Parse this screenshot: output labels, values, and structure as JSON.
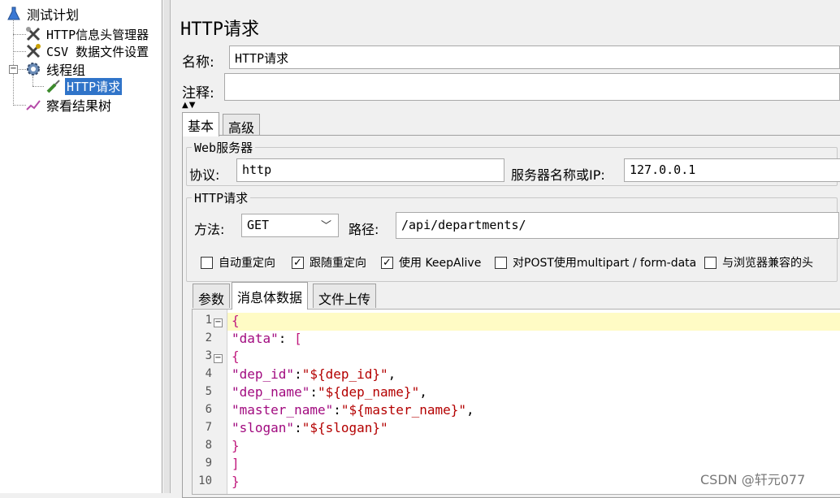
{
  "tree": {
    "root": "测试计划",
    "header_manager": "HTTP信息头管理器",
    "csv_config": "CSV 数据文件设置",
    "thread_group": "线程组",
    "http_request": "HTTP请求",
    "result_tree": "察看结果树"
  },
  "panel": {
    "title": "HTTP请求",
    "name_label": "名称:",
    "name_value": "HTTP请求",
    "comment_label": "注释:",
    "comment_value": ""
  },
  "tabs": {
    "basic": "基本",
    "advanced": "高级"
  },
  "web_server": {
    "legend": "Web服务器",
    "protocol_label": "协议:",
    "protocol_value": "http",
    "server_label": "服务器名称或IP:",
    "server_value": "127.0.0.1"
  },
  "http_section": {
    "legend": "HTTP请求",
    "method_label": "方法:",
    "method_value": "GET",
    "path_label": "路径:",
    "path_value": "/api/departments/"
  },
  "checkboxes": [
    {
      "label": "自动重定向",
      "checked": false
    },
    {
      "label": "跟随重定向",
      "checked": true
    },
    {
      "label": "使用 KeepAlive",
      "checked": true
    },
    {
      "label": "对POST使用multipart / form-data",
      "checked": false
    },
    {
      "label": "与浏览器兼容的头",
      "checked": false
    }
  ],
  "subtabs": {
    "params": "参数",
    "body": "消息体数据",
    "files": "文件上传"
  },
  "editor": {
    "line_numbers": [
      "1",
      "2",
      "3",
      "4",
      "5",
      "6",
      "7",
      "8",
      "9",
      "10"
    ],
    "lines": [
      "{",
      "\"data\": [",
      "{",
      "\"dep_id\":\"${dep_id}\",",
      "\"dep_name\":\"${dep_name}\",",
      "\"master_name\":\"${master_name}\",",
      "\"slogan\":\"${slogan}\"",
      "}",
      "]",
      "}"
    ]
  },
  "watermark": "CSDN @轩元077"
}
